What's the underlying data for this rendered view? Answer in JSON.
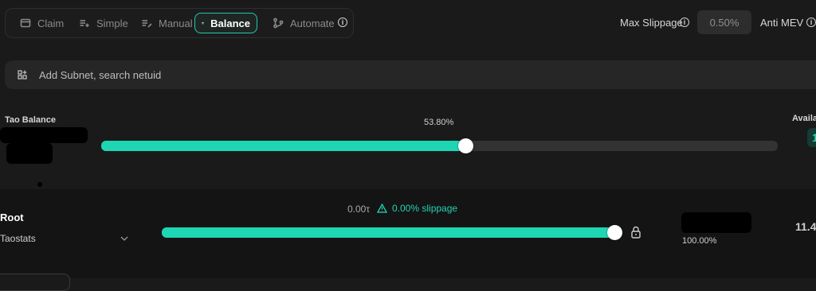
{
  "tabs": [
    {
      "label": "Claim",
      "icon": "wallet-icon"
    },
    {
      "label": "Simple",
      "icon": "list-plus-icon"
    },
    {
      "label": "Manual",
      "icon": "list-edit-icon"
    },
    {
      "label": "Balance",
      "icon": "scale-icon",
      "active": true
    },
    {
      "label": "Automate",
      "icon": "git-branch-icon"
    }
  ],
  "header": {
    "max_slippage_label": "Max Slippage",
    "max_slippage_value": "0.50%",
    "anti_mev_label": "Anti MEV"
  },
  "search": {
    "placeholder": "Add Subnet, search netuid"
  },
  "tao_balance": {
    "label": "Tao Balance",
    "percent_label": "53.80%",
    "slider_fraction": 0.538,
    "available_label": "Availa",
    "available_value": "1"
  },
  "root_row": {
    "name": "Root",
    "validator": "Taostats",
    "amount": "0.00τ",
    "slippage": "0.00% slippage",
    "slider_fraction": 1.0,
    "percent": "100.00%",
    "value": "11.4"
  },
  "colors": {
    "accent": "#1fd6b4",
    "background": "#1a1a1a",
    "panel": "#262626"
  }
}
